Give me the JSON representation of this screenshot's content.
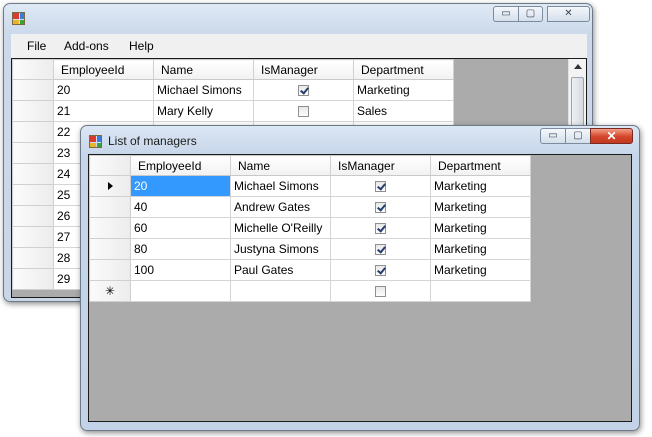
{
  "main_window": {
    "title": "",
    "menu": [
      "File",
      "Add-ons",
      "Help"
    ],
    "caption_buttons": {
      "minimize": "▭",
      "maximize": "▢",
      "close": "✕"
    },
    "grid": {
      "columns": [
        "EmployeeId",
        "Name",
        "IsManager",
        "Department"
      ],
      "rows": [
        {
          "id": "20",
          "name": "Michael Simons",
          "is_manager": true,
          "department": "Marketing"
        },
        {
          "id": "21",
          "name": "Mary Kelly",
          "is_manager": false,
          "department": "Sales"
        },
        {
          "id": "22",
          "name": "",
          "is_manager": false,
          "department": ""
        },
        {
          "id": "23",
          "name": "",
          "is_manager": false,
          "department": ""
        },
        {
          "id": "24",
          "name": "",
          "is_manager": false,
          "department": ""
        },
        {
          "id": "25",
          "name": "",
          "is_manager": false,
          "department": ""
        },
        {
          "id": "26",
          "name": "",
          "is_manager": false,
          "department": ""
        },
        {
          "id": "27",
          "name": "",
          "is_manager": false,
          "department": ""
        },
        {
          "id": "28",
          "name": "",
          "is_manager": false,
          "department": ""
        },
        {
          "id": "29",
          "name": "",
          "is_manager": false,
          "department": ""
        }
      ]
    }
  },
  "managers_window": {
    "title": "List of managers",
    "caption_buttons": {
      "minimize": "▭",
      "maximize": "▢",
      "close": "✕"
    },
    "grid": {
      "columns": [
        "EmployeeId",
        "Name",
        "IsManager",
        "Department"
      ],
      "current_row_marker": "▶",
      "new_row_marker": "✳",
      "rows": [
        {
          "id": "20",
          "name": "Michael Simons",
          "is_manager": true,
          "department": "Marketing"
        },
        {
          "id": "40",
          "name": "Andrew Gates",
          "is_manager": true,
          "department": "Marketing"
        },
        {
          "id": "60",
          "name": "Michelle O'Reilly",
          "is_manager": true,
          "department": "Marketing"
        },
        {
          "id": "80",
          "name": "Justyna Simons",
          "is_manager": true,
          "department": "Marketing"
        },
        {
          "id": "100",
          "name": "Paul Gates",
          "is_manager": true,
          "department": "Marketing"
        }
      ]
    }
  }
}
